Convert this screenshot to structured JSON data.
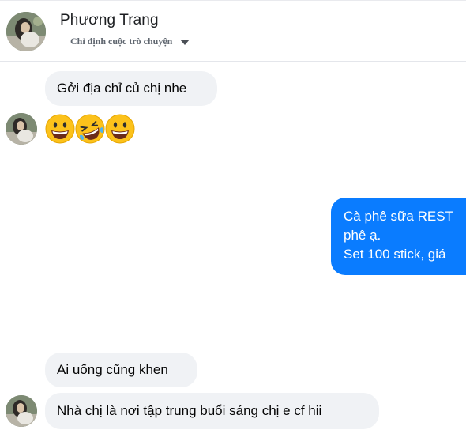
{
  "header": {
    "name": "Phương Trang",
    "subtitle": "Chỉ định cuộc trò chuyện"
  },
  "messages": [
    {
      "side": "in",
      "text": "Gởi địa chỉ củ chị nhe"
    },
    {
      "side": "in",
      "emojis": [
        "grinning-face",
        "rolling-on-floor-laughing",
        "grinning-face"
      ]
    },
    {
      "side": "out",
      "lines": [
        "Cà phê sữa REST",
        "phê ạ.",
        "Set 100 stick, giá"
      ]
    },
    {
      "side": "in",
      "text": "Ai uống cũng khen"
    },
    {
      "side": "in",
      "text": "Nhà chị là nơi tập trung buổi sáng chị e cf hii"
    }
  ],
  "colors": {
    "incoming_bubble": "#f0f2f5",
    "outgoing_bubble": "#0a7cff",
    "outgoing_text": "#ffffff",
    "incoming_text": "#050505"
  },
  "icons": {
    "dropdown": "caret-down-icon",
    "avatar": "profile-photo"
  }
}
